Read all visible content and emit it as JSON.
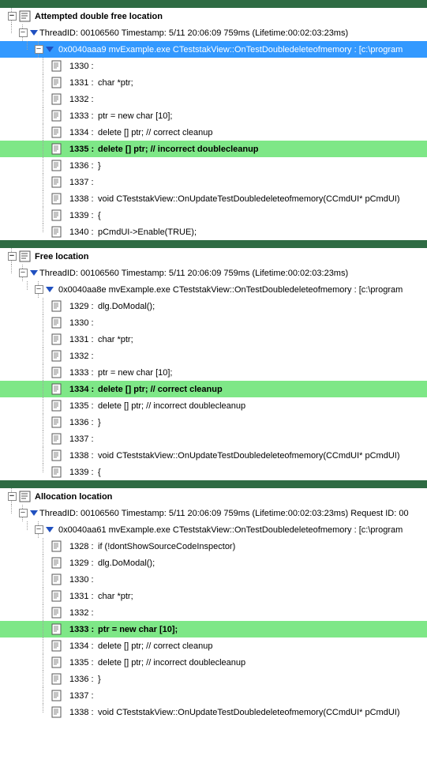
{
  "sections": [
    {
      "title": "Attempted double free location",
      "thread": "ThreadID: 00106560 Timestamp: 5/11 20:06:09 759ms (Lifetime:00:02:03:23ms)",
      "stack": "0x0040aaa9 mvExample.exe  CTeststakView::OnTestDoubledeleteofmemory : [c:\\program",
      "stack_selected": true,
      "highlight_index": 5,
      "lines": [
        {
          "ln": "1330 :",
          "code": ""
        },
        {
          "ln": "1331 :",
          "code": "   char    *ptr;"
        },
        {
          "ln": "1332 :",
          "code": ""
        },
        {
          "ln": "1333 :",
          "code": "   ptr = new char [10];"
        },
        {
          "ln": "1334 :",
          "code": "   delete [] ptr;             // correct cleanup"
        },
        {
          "ln": "1335 :",
          "code": "   delete [] ptr;             // incorrect doublecleanup"
        },
        {
          "ln": "1336 :",
          "code": "}"
        },
        {
          "ln": "1337 :",
          "code": ""
        },
        {
          "ln": "1338 :",
          "code": "void CTeststakView::OnUpdateTestDoubledeleteofmemory(CCmdUI* pCmdUI)"
        },
        {
          "ln": "1339 :",
          "code": "{"
        },
        {
          "ln": "1340 :",
          "code": "   pCmdUI->Enable(TRUE);"
        }
      ]
    },
    {
      "title": "Free location",
      "thread": "ThreadID: 00106560 Timestamp: 5/11 20:06:09 759ms (Lifetime:00:02:03:23ms)",
      "stack": "0x0040aa8e mvExample.exe  CTeststakView::OnTestDoubledeleteofmemory : [c:\\program",
      "stack_selected": false,
      "highlight_index": 5,
      "lines": [
        {
          "ln": "1329 :",
          "code": "      dlg.DoModal();"
        },
        {
          "ln": "1330 :",
          "code": ""
        },
        {
          "ln": "1331 :",
          "code": "   char    *ptr;"
        },
        {
          "ln": "1332 :",
          "code": ""
        },
        {
          "ln": "1333 :",
          "code": "   ptr = new char [10];"
        },
        {
          "ln": "1334 :",
          "code": "   delete [] ptr;             // correct cleanup"
        },
        {
          "ln": "1335 :",
          "code": "   delete [] ptr;             // incorrect doublecleanup"
        },
        {
          "ln": "1336 :",
          "code": "}"
        },
        {
          "ln": "1337 :",
          "code": ""
        },
        {
          "ln": "1338 :",
          "code": "void CTeststakView::OnUpdateTestDoubledeleteofmemory(CCmdUI* pCmdUI)"
        },
        {
          "ln": "1339 :",
          "code": "{"
        }
      ]
    },
    {
      "title": "Allocation location",
      "thread": "ThreadID: 00106560 Timestamp: 5/11 20:06:09 759ms (Lifetime:00:02:03:23ms) Request ID: 00",
      "stack": "0x0040aa61 mvExample.exe  CTeststakView::OnTestDoubledeleteofmemory : [c:\\program",
      "stack_selected": false,
      "highlight_index": 5,
      "lines": [
        {
          "ln": "1328 :",
          "code": "   if (!dontShowSourceCodeInspector)"
        },
        {
          "ln": "1329 :",
          "code": "      dlg.DoModal();"
        },
        {
          "ln": "1330 :",
          "code": ""
        },
        {
          "ln": "1331 :",
          "code": "   char    *ptr;"
        },
        {
          "ln": "1332 :",
          "code": ""
        },
        {
          "ln": "1333 :",
          "code": "   ptr = new char [10];"
        },
        {
          "ln": "1334 :",
          "code": "   delete [] ptr;             // correct cleanup"
        },
        {
          "ln": "1335 :",
          "code": "   delete [] ptr;             // incorrect doublecleanup"
        },
        {
          "ln": "1336 :",
          "code": "}"
        },
        {
          "ln": "1337 :",
          "code": ""
        },
        {
          "ln": "1338 :",
          "code": "void CTeststakView::OnUpdateTestDoubledeleteofmemory(CCmdUI* pCmdUI)"
        }
      ]
    }
  ]
}
